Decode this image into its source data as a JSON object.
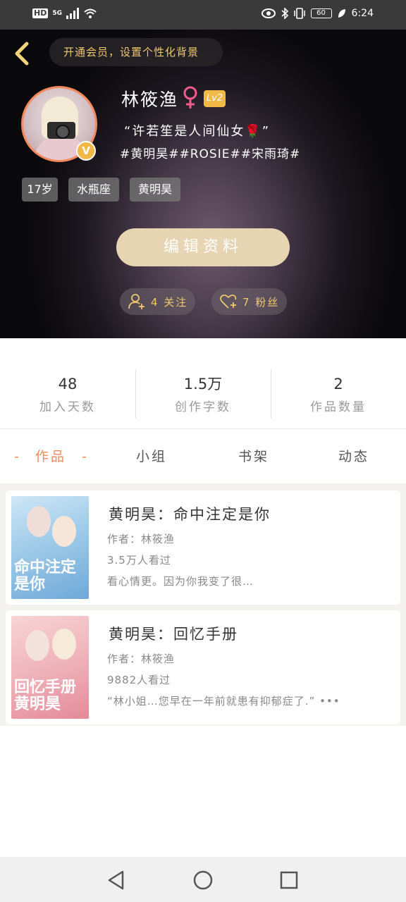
{
  "status_bar": {
    "left_items": [
      "HD",
      "5G"
    ],
    "battery": "60",
    "time": "6:24",
    "icons": [
      "signal-icon",
      "wifi-icon",
      "eye-icon",
      "bluetooth-icon",
      "vibrate-icon",
      "battery-icon",
      "leaf-icon"
    ]
  },
  "header": {
    "vip_banner": "开通会员，设置个性化背景"
  },
  "profile": {
    "name": "林筱渔",
    "level": "Lv2",
    "verified_badge": "V",
    "bio": "“许若笙是人间仙女🌹”",
    "hashtags": "#黄明昊##ROSIE##宋雨琦#",
    "tags": [
      "17岁",
      "水瓶座",
      "黄明昊"
    ],
    "edit_button": "编辑资料",
    "following": "4 关注",
    "followers": "7 粉丝"
  },
  "stats": [
    {
      "value": "48",
      "label": "加入天数"
    },
    {
      "value": "1.5万",
      "label": "创作字数"
    },
    {
      "value": "2",
      "label": "作品数量"
    }
  ],
  "tabs": {
    "active_decor": "-",
    "items": [
      "作品",
      "小组",
      "书架",
      "动态"
    ]
  },
  "works": [
    {
      "title": "黄明昊：命中注定是你",
      "author": "作者：林筱渔",
      "views": "3.5万人看过",
      "summary": "看心情更。因为你我变了很…",
      "cover_text": "命中注定是你"
    },
    {
      "title": "黄明昊：回忆手册",
      "author": "作者：林筱渔",
      "views": "9882人看过",
      "summary": "“林小姐…您早在一年前就患有抑郁症了.” •••",
      "cover_text": "回忆手册黄明昊"
    }
  ],
  "colors": {
    "accent": "#f28a5c",
    "gold": "#f2b845",
    "banner_text": "#f0c86a",
    "edit_button": "#e6d4b2"
  }
}
